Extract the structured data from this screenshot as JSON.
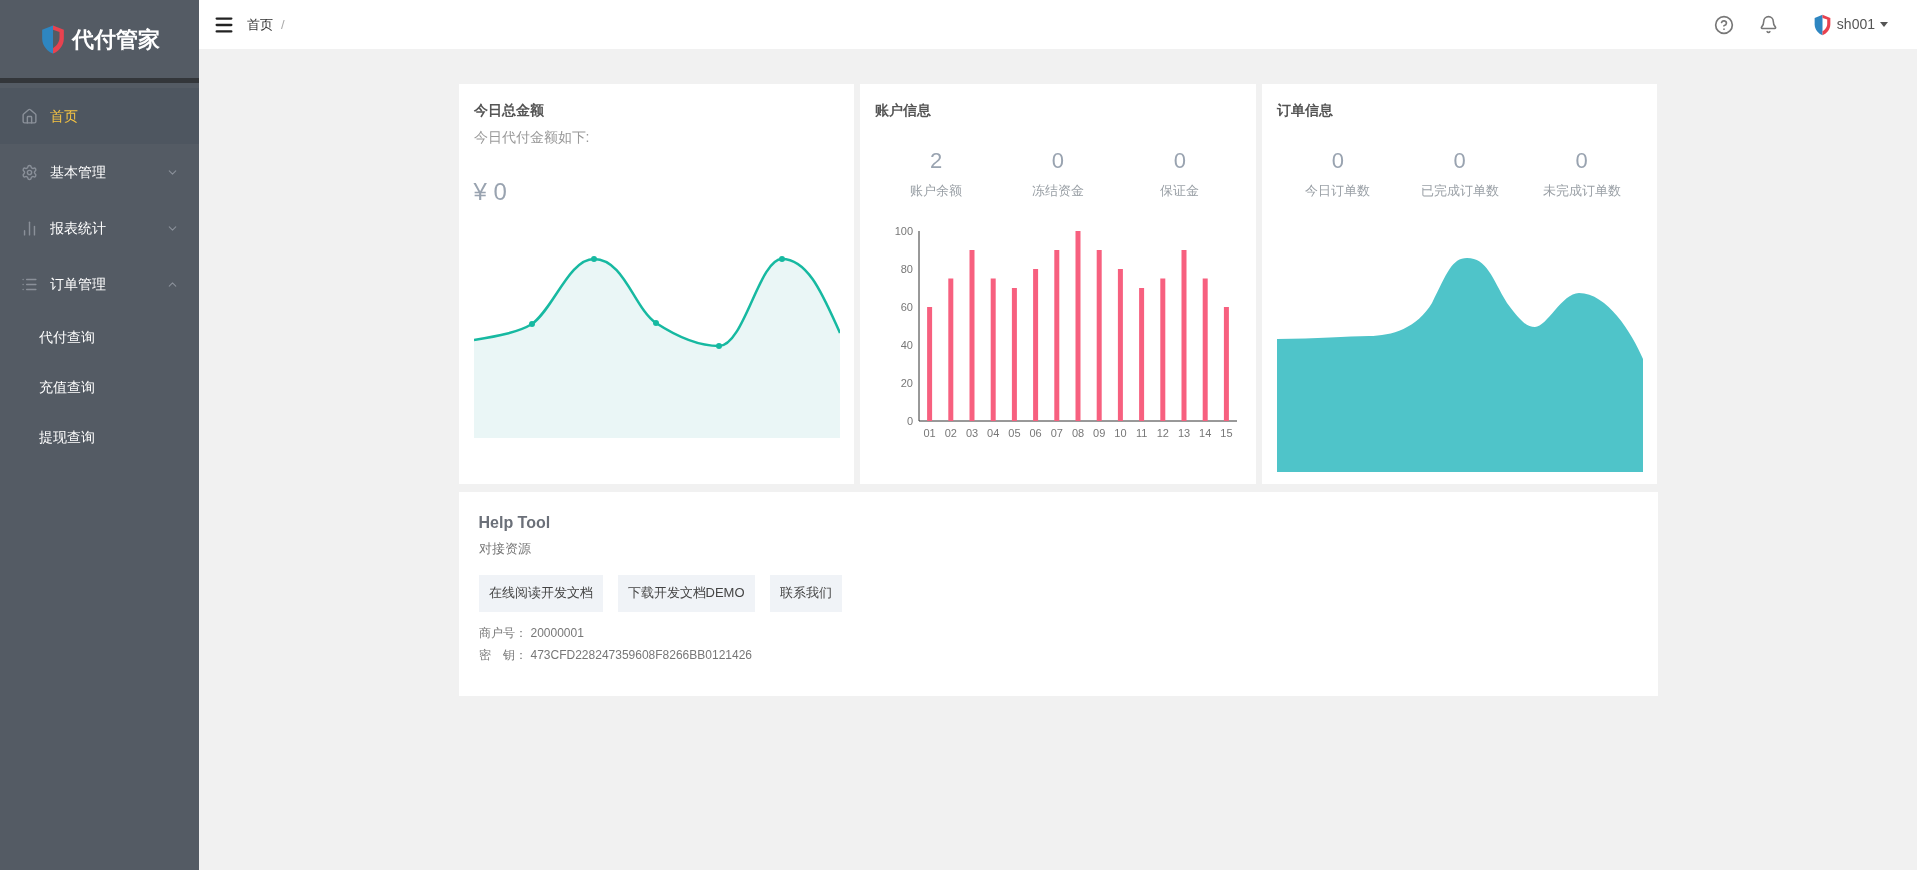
{
  "sidebar": {
    "logo_text": "代付管家",
    "items": [
      {
        "kind": "link",
        "label": "首页",
        "selected": true
      },
      {
        "kind": "group",
        "label": "基本管理",
        "selected": false,
        "expanded": false
      },
      {
        "kind": "group",
        "label": "报表统计",
        "selected": false,
        "expanded": false
      },
      {
        "kind": "group",
        "label": "订单管理",
        "selected": false,
        "expanded": true,
        "children": [
          {
            "label": "代付查询",
            "selected": false
          },
          {
            "label": "充值查询",
            "selected": false
          },
          {
            "label": "提现查询",
            "selected": false
          }
        ]
      }
    ]
  },
  "topbar": {
    "breadcrumb": [
      "首页",
      "/"
    ],
    "user": "sh001"
  },
  "cards": {
    "today_total": {
      "title": "今日总金额",
      "subtitle": "今日代付金额如下:",
      "amount": "¥ 0"
    },
    "account": {
      "title": "账户信息",
      "stats": [
        {
          "value": "2",
          "label": "账户余额"
        },
        {
          "value": "0",
          "label": "冻结资金"
        },
        {
          "value": "0",
          "label": "保证金"
        }
      ],
      "chart_data": {
        "type": "bar",
        "categories": [
          "01",
          "02",
          "03",
          "04",
          "05",
          "06",
          "07",
          "08",
          "09",
          "10",
          "11",
          "12",
          "13",
          "14",
          "15"
        ],
        "series": [
          {
            "color": "#f7607f",
            "values": [
              60,
              75,
              90,
              75,
              70,
              80,
              90,
              100,
              90,
              80,
              70,
              75,
              90,
              75,
              60
            ]
          }
        ],
        "ylim": [
          0,
          100
        ],
        "yticks": [
          0,
          20,
          40,
          60,
          80,
          100
        ]
      }
    },
    "orders": {
      "title": "订单信息",
      "stats": [
        {
          "value": "0",
          "label": "今日订单数"
        },
        {
          "value": "0",
          "label": "已完成订单数"
        },
        {
          "value": "0",
          "label": "未完成订单数"
        }
      ]
    }
  },
  "help_tool": {
    "title": "Help Tool",
    "subtitle": "对接资源",
    "buttons": [
      "在线阅读开发文档",
      "下载开发文档DEMO",
      "联系我们"
    ],
    "fields": [
      {
        "label": "商户号：",
        "value": "20000001"
      },
      {
        "label": "密　钥：",
        "value": "473CFD228247359608F8266BB0121426"
      }
    ]
  }
}
